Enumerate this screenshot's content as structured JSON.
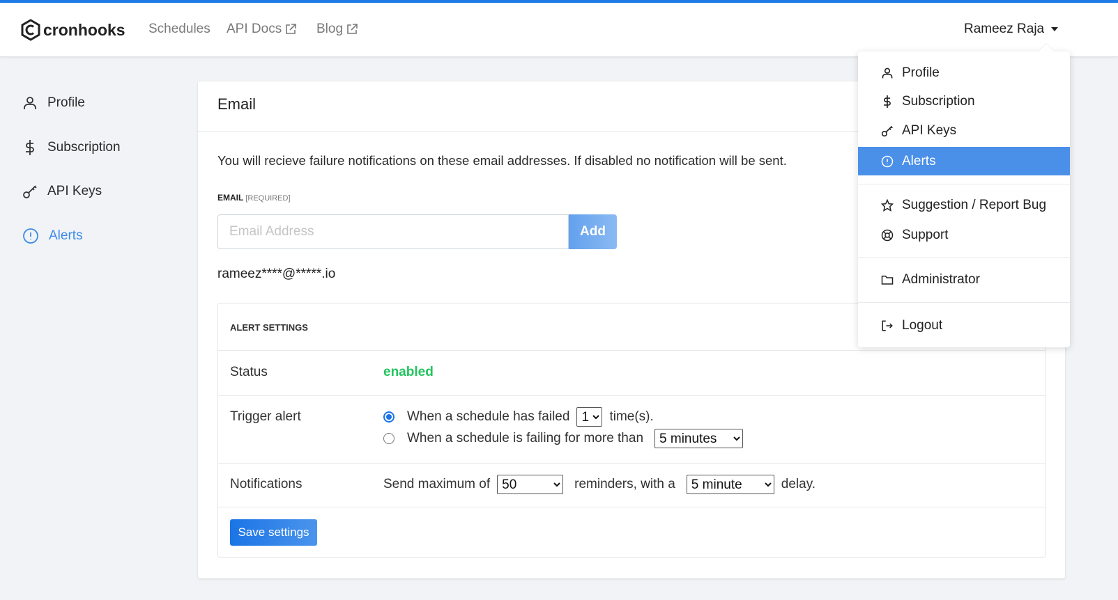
{
  "header": {
    "brand": "cronhooks",
    "nav": [
      {
        "label": "Schedules"
      },
      {
        "label": "API Docs",
        "external": true
      },
      {
        "label": "Blog",
        "external": true
      }
    ],
    "user": "Rameez Raja"
  },
  "sidebar": {
    "items": [
      {
        "label": "Profile",
        "icon": "user-icon"
      },
      {
        "label": "Subscription",
        "icon": "dollar-icon"
      },
      {
        "label": "API Keys",
        "icon": "key-icon"
      },
      {
        "label": "Alerts",
        "icon": "alert-circle-icon",
        "active": true
      }
    ]
  },
  "main": {
    "title": "Email",
    "description": "You will recieve failure notifications on these email addresses. If disabled no notification will be sent.",
    "email_label": "EMAIL",
    "email_required": "[REQUIRED]",
    "email_placeholder": "Email Address",
    "add_label": "Add",
    "emails": [
      "rameez****@*****.io"
    ],
    "alert_settings": {
      "title": "ALERT SETTINGS",
      "status_label": "Status",
      "status_value": "enabled",
      "status_color": "#22c55e",
      "trigger_label": "Trigger alert",
      "trigger_option1": "When a schedule has failed",
      "trigger_count": "1",
      "trigger_option1_suffix": "time(s).",
      "trigger_option2": "When a schedule is failing for more than",
      "trigger_duration": "5 minutes",
      "trigger_selected": 1,
      "notifications_label": "Notifications",
      "notif_prefix": "Send maximum of",
      "notif_max": "50",
      "notif_middle": "reminders, with a",
      "notif_delay": "5 minute",
      "notif_suffix": "delay.",
      "save_label": "Save settings"
    }
  },
  "user_menu": {
    "items": [
      {
        "label": "Profile"
      },
      {
        "label": "Subscription"
      },
      {
        "label": "API Keys"
      },
      {
        "label": "Alerts",
        "active": true
      },
      {
        "label": "Suggestion / Report Bug"
      },
      {
        "label": "Support"
      },
      {
        "label": "Administrator"
      },
      {
        "label": "Logout"
      }
    ]
  },
  "colors": {
    "accent": "#1f7ae6",
    "menu_active": "#4a90e8",
    "sidebar_active": "#3d8be8"
  }
}
